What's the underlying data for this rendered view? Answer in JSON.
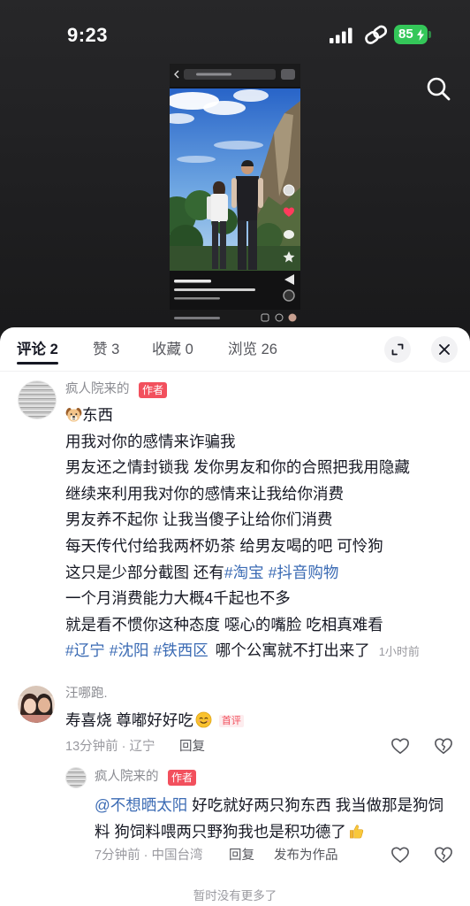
{
  "status_bar": {
    "time": "9:23",
    "battery_level": "85",
    "icons": [
      "signal-icon",
      "link-icon",
      "battery-charging-icon"
    ]
  },
  "header": {
    "search_icon": "search-icon"
  },
  "tabs": [
    {
      "label": "评论 2",
      "active": true
    },
    {
      "label": "赞 3",
      "active": false
    },
    {
      "label": "收藏 0",
      "active": false
    },
    {
      "label": "浏览 26",
      "active": false
    }
  ],
  "sheet_buttons": {
    "expand_icon": "expand-icon",
    "close_icon": "close-icon"
  },
  "comments": [
    {
      "author": "疯人院来的",
      "badge": "作者",
      "lines": [
        [
          {
            "emoji": "dog-face"
          },
          {
            "text": "东西"
          }
        ],
        [
          {
            "text": "用我对你的感情来诈骗我"
          }
        ],
        [
          {
            "text": "男友还之情封锁我 发你男友和你的合照把我用隐藏"
          }
        ],
        [
          {
            "text": "继续来利用我对你的感情来让我给你消费"
          }
        ],
        [
          {
            "text": "男友养不起你 让我当傻子让给你们消费"
          }
        ],
        [
          {
            "text": "每天传代付给我两杯奶茶 给男友喝的吧 可怜狗"
          }
        ],
        [
          {
            "text": "这只是少部分截图 还有"
          },
          {
            "text": "#淘宝",
            "hashtag": true
          },
          {
            "text": "#抖音购物",
            "hashtag": true
          }
        ],
        [
          {
            "text": "一个月消费能力大概4千起也不多"
          }
        ],
        [
          {
            "text": "就是看不惯你这种态度 噁心的嘴脸 吃相真难看"
          }
        ],
        [
          {
            "text": "#辽宁",
            "hashtag": true
          },
          {
            "text": "#沈阳",
            "hashtag": true
          },
          {
            "text": "#铁西区",
            "hashtag": true
          },
          {
            "text": "哪个公寓就不打出来了"
          }
        ]
      ],
      "time": "1小时前"
    },
    {
      "author": "汪哪跑.",
      "text": "寿喜烧 尊嘟好好吃",
      "emoji": "smiling-face",
      "tag": "首评",
      "meta": "13分钟前 · 辽宁",
      "reply_label": "回复",
      "actions": [
        "heart-icon",
        "dislike-icon"
      ],
      "replies": [
        {
          "author": "疯人院来的",
          "badge": "作者",
          "mention": "@不想晒太阳",
          "text": "好吃就好两只狗东西 我当做那是狗饲料 狗饲料喂两只野狗我也是积功德了",
          "emoji": "thumbs-up",
          "meta": "7分钟前 · 中国台湾",
          "reply_label": "回复",
          "publish_label": "发布为作品",
          "actions": [
            "heart-icon",
            "dislike-icon"
          ]
        }
      ]
    }
  ],
  "footer": "暂时没有更多了",
  "colors": {
    "link": "#3b6bb4",
    "author_badge": "#f2505d",
    "battery": "#34c759",
    "muted_text": "#8a8b91"
  }
}
